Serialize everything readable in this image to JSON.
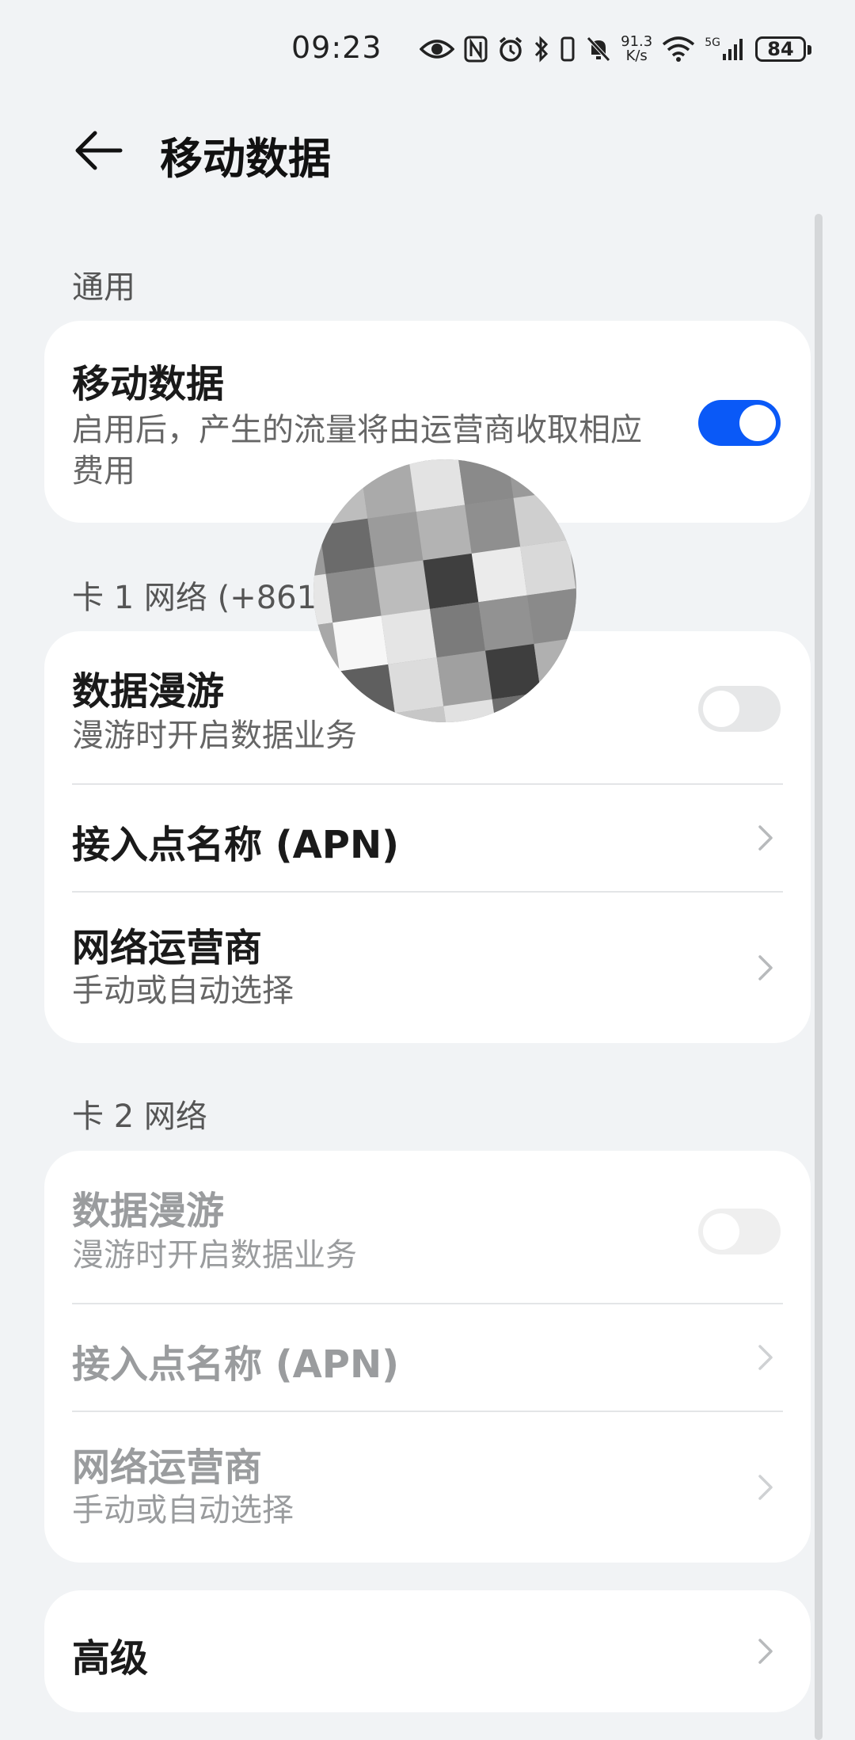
{
  "status_bar": {
    "time": "09:23",
    "net_speed_value": "91.3",
    "net_speed_unit": "K/s",
    "network_type": "5G",
    "battery": "84"
  },
  "header": {
    "title": "移动数据"
  },
  "general": {
    "section_label": "通用",
    "mobile_data": {
      "title": "移动数据",
      "subtitle": "启用后，产生的流量将由运营商收取相应费用",
      "enabled": true
    }
  },
  "sim1": {
    "section_label": "卡 1 网络 (+861",
    "roaming": {
      "title": "数据漫游",
      "subtitle": "漫游时开启数据业务",
      "enabled": false
    },
    "apn": {
      "title": "接入点名称 (APN)"
    },
    "operator": {
      "title": "网络运营商",
      "subtitle": "手动或自动选择"
    }
  },
  "sim2": {
    "section_label": "卡 2 网络",
    "roaming": {
      "title": "数据漫游",
      "subtitle": "漫游时开启数据业务",
      "enabled": false
    },
    "apn": {
      "title": "接入点名称 (APN)"
    },
    "operator": {
      "title": "网络运营商",
      "subtitle": "手动或自动选择"
    }
  },
  "advanced": {
    "title": "高级"
  },
  "colors": {
    "accent": "#0a59f7",
    "background": "#f1f3f5",
    "card": "#ffffff"
  },
  "icons": [
    "eye-icon",
    "nfc-icon",
    "alarm-icon",
    "bluetooth-icon",
    "vibrate-icon",
    "mute-icon",
    "wifi-icon",
    "signal-icon",
    "battery-icon",
    "back-arrow-icon",
    "chevron-right-icon"
  ]
}
